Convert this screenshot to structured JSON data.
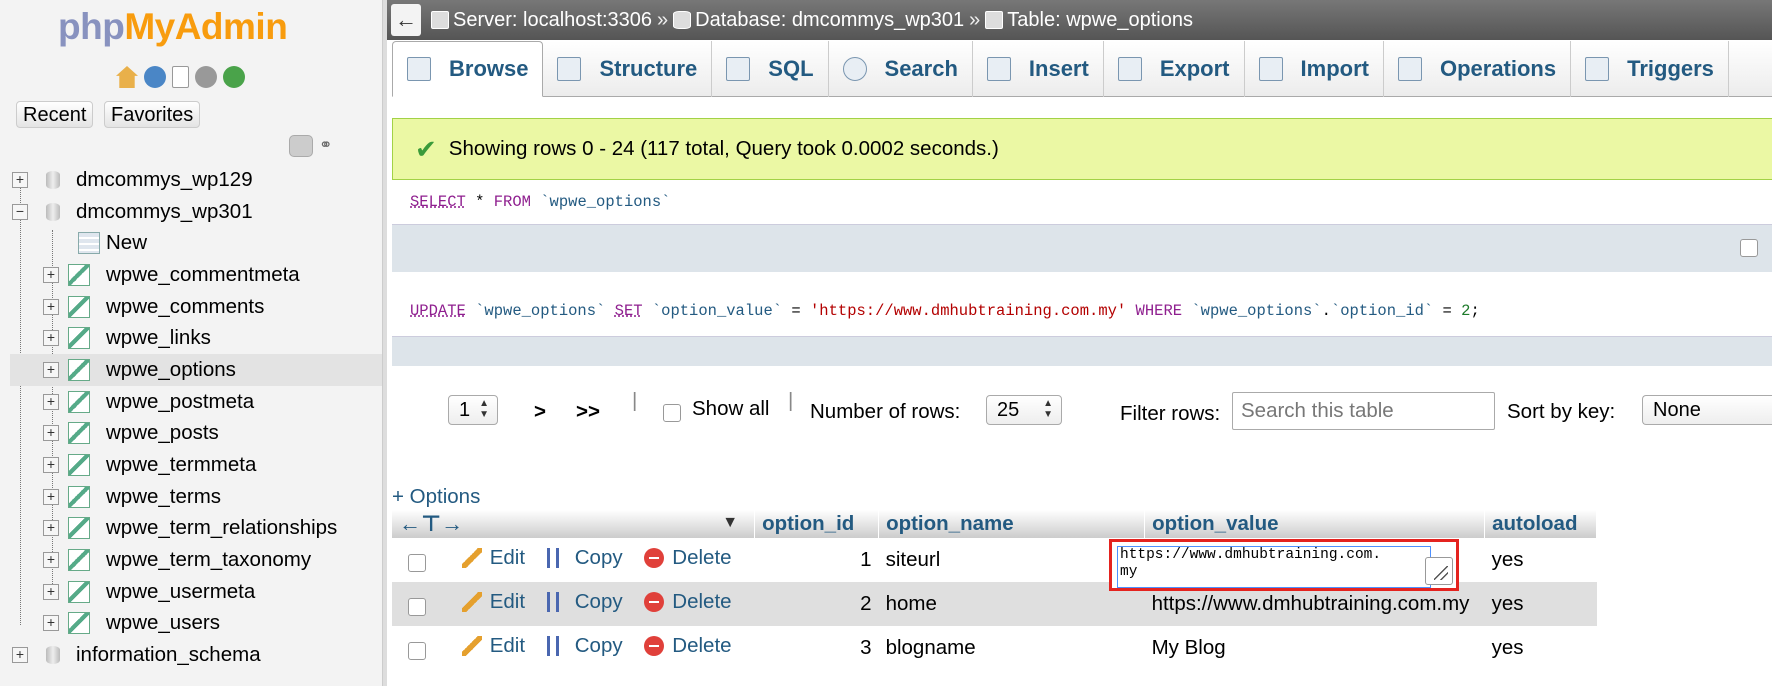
{
  "nav": {
    "logo_php": "php",
    "logo_myadmin": "MyAdmin",
    "recent_label": "Recent",
    "favorites_label": "Favorites",
    "databases": [
      {
        "name": "dmcommys_wp129",
        "expanded": false
      },
      {
        "name": "dmcommys_wp301",
        "expanded": true
      },
      {
        "name": "information_schema",
        "expanded": false
      }
    ],
    "new_label": "New",
    "tables": [
      "wpwe_commentmeta",
      "wpwe_comments",
      "wpwe_links",
      "wpwe_options",
      "wpwe_postmeta",
      "wpwe_posts",
      "wpwe_termmeta",
      "wpwe_terms",
      "wpwe_term_relationships",
      "wpwe_term_taxonomy",
      "wpwe_usermeta",
      "wpwe_users"
    ],
    "selected_table": "wpwe_options"
  },
  "breadcrumb": {
    "server": "Server: localhost:3306",
    "database": "Database: dmcommys_wp301",
    "table": "Table: wpwe_options",
    "separator": "»"
  },
  "tabs": [
    "Browse",
    "Structure",
    "SQL",
    "Search",
    "Insert",
    "Export",
    "Import",
    "Operations",
    "Triggers"
  ],
  "active_tab": "Browse",
  "success_message": "Showing rows 0 - 24 (117 total, Query took 0.0002 seconds.)",
  "sql1": {
    "select": "SELECT",
    "star": " * ",
    "from": "FROM",
    "table": " `wpwe_options`"
  },
  "sql2": {
    "update": "UPDATE",
    "table": " `wpwe_options` ",
    "set": "SET",
    "col": " `option_value` ",
    "eq": "= ",
    "value": "'https://www.dmhubtraining.com.my'",
    "where": " WHERE ",
    "cond_table": "`wpwe_options`",
    "dot": ".",
    "cond_col": "`option_id`",
    "eq2": " = ",
    "num": "2",
    "semicolon": ";"
  },
  "pager": {
    "page": "1",
    "next": ">",
    "last": ">>",
    "divider": "|",
    "show_all": "Show all",
    "rows_label": "Number of rows:",
    "rows_value": "25",
    "filter_label": "Filter rows:",
    "filter_placeholder": "Search this table",
    "sort_label": "Sort by key:",
    "sort_value": "None"
  },
  "options_link": "+ Options",
  "columns": [
    "option_id",
    "option_name",
    "option_value",
    "autoload"
  ],
  "actions": {
    "edit": "Edit",
    "copy": "Copy",
    "delete": "Delete"
  },
  "rows": [
    {
      "option_id": "1",
      "option_name": "siteurl",
      "option_value": "https://www.dmhubtraining.com.\nmy",
      "autoload": "yes"
    },
    {
      "option_id": "2",
      "option_name": "home",
      "option_value": "https://www.dmhubtraining.com.my",
      "autoload": "yes"
    },
    {
      "option_id": "3",
      "option_name": "blogname",
      "option_value": "My Blog",
      "autoload": "yes"
    }
  ],
  "colors": {
    "link": "#235a81",
    "success_bg": "#ebf8a4",
    "highlight_box": "#e4231f"
  }
}
